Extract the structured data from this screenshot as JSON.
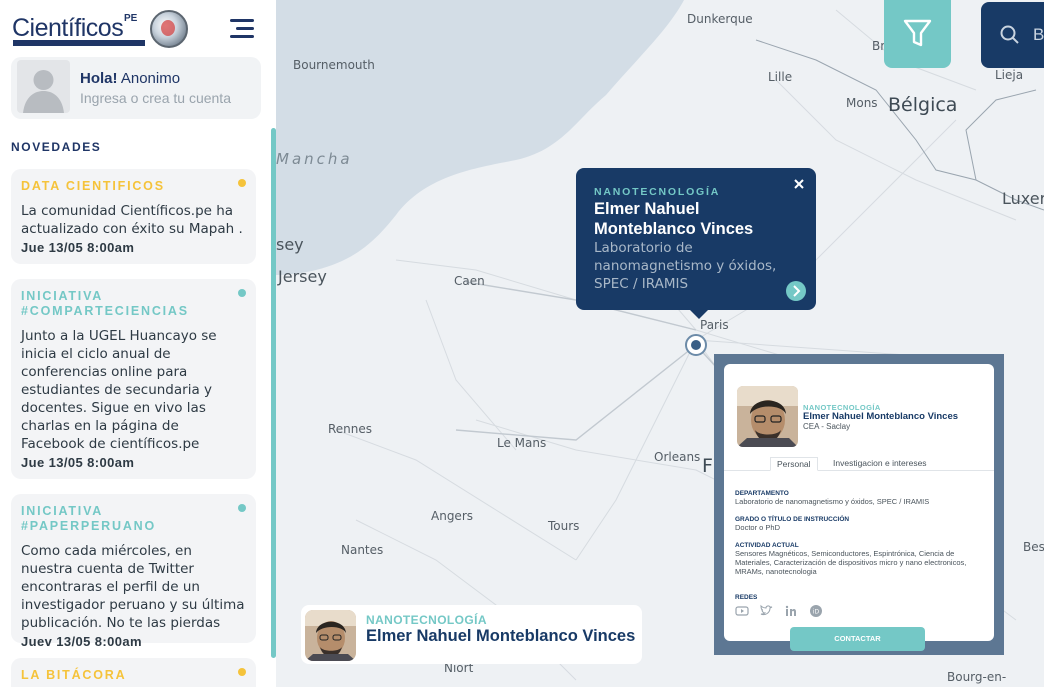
{
  "brand": {
    "name": "Científicos",
    "suffix": "PE"
  },
  "user": {
    "greeting": "Hola!",
    "name": "Anonimo",
    "login_prompt": "Ingresa o crea tu cuenta"
  },
  "news": {
    "title": "NOVEDADES",
    "items": [
      {
        "tag": "DATA CIENTIFICOS",
        "body": "La comunidad Científicos.pe ha actualizado con éxito su Mapah .",
        "date": "Jue 13/05 8:00am",
        "tag_color": "#f5c33b"
      },
      {
        "tag": "INICIATIVA #COMPARTECIENCIAS",
        "body": "Junto a la UGEL Huancayo se inicia el ciclo anual de conferencias online para estudiantes de secundaria y docentes. Sigue en vivo las charlas en la página de Facebook de científicos.pe",
        "date": "Jue 13/05 8:00am",
        "tag_color": "#74c8c6"
      },
      {
        "tag": "INICIATIVA #PAPERPERUANO",
        "body": "Como cada miércoles, en nuestra cuenta de Twitter encontraras el perfil de un investigador peruano y su última publicación. No te las pierdas",
        "date": "Juev 13/05 8:00am",
        "tag_color": "#74c8c6"
      },
      {
        "tag": "LA BITÁCORA",
        "body": "",
        "date": "",
        "tag_color": "#f5c33b"
      }
    ]
  },
  "search": {
    "text": "B"
  },
  "map": {
    "places": [
      "Dunkerque",
      "Br",
      "Bournemouth",
      "Lille",
      "Lieja",
      "Mons",
      "Bélgica",
      "Mancha",
      "Luxer",
      "sey",
      "Jersey",
      "Caen",
      "Paris",
      "Rennes",
      "Le Mans",
      "Orleans",
      "F",
      "Angers",
      "Tours",
      "Nantes",
      "Bes",
      "Niort",
      "Bourg-en-"
    ]
  },
  "popup": {
    "category": "NANOTECNOLOGÍA",
    "name": "Elmer Nahuel Monteblanco Vinces",
    "affiliation": "Laboratorio de nanomagnetismo y óxidos, SPEC / IRAMIS"
  },
  "profile": {
    "category": "NANOTECNOLOGÍA",
    "name": "Elmer Nahuel Monteblanco Vinces",
    "affiliation": "CEA - Saclay",
    "tabs": [
      "Personal",
      "Investigacion e intereses"
    ],
    "department_label": "DEPARTAMENTO",
    "department": "Laboratorio de nanomagnetismo y óxidos, SPEC / IRAMIS",
    "degree_label": "GRADO O TÍTULO DE INSTRUCCIÓN",
    "degree": "Doctor o PhD",
    "activity_label": "ACTIVIDAD ACTUAL",
    "activity": "Sensores Magnéticos, Semiconductores, Espintrónica, Ciencia de Materiales, Caracterización de dispositivos micro y nano electronicos, MRAMs, nanotecnologia",
    "social_label": "REDES",
    "social_icons": [
      "youtube-icon",
      "twitter-icon",
      "linkedin-icon",
      "orcid-icon"
    ],
    "contact_label": "CONTACTAR"
  },
  "bottom_card": {
    "category": "NANOTECNOLOGÍA",
    "name": "Elmer Nahuel Monteblanco Vinces"
  },
  "colors": {
    "primary": "#183a66",
    "accent": "#74c8c6",
    "highlight": "#f5c33b"
  }
}
